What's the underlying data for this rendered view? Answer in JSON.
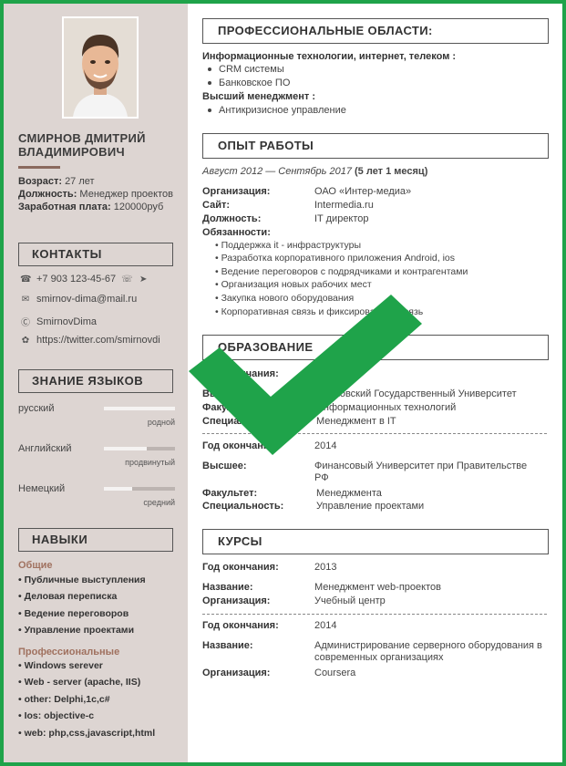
{
  "profile": {
    "name_line1": "СМИРНОВ ДМИТРИЙ",
    "name_line2": "ВЛАДИМИРОВИЧ",
    "age_label": "Возраст:",
    "age_value": "27 лет",
    "position_label": "Должность:",
    "position_value": "Менеджер проектов",
    "salary_label": "Заработная плата:",
    "salary_value": "120000руб"
  },
  "contacts": {
    "title": "КОНТАКТЫ",
    "phone": "+7 903 123-45-67",
    "email": "smirnov-dima@mail.ru",
    "skype": "SmirnovDima",
    "twitter": "https://twitter.com/smirnovdi"
  },
  "languages": {
    "title": "ЗНАНИЕ ЯЗЫКОВ",
    "items": [
      {
        "name": "русский",
        "level": "родной",
        "fill": 1.0
      },
      {
        "name": "Английский",
        "level": "продвинутый",
        "fill": 0.6
      },
      {
        "name": "Немецкий",
        "level": "средний",
        "fill": 0.4
      }
    ]
  },
  "skills": {
    "title": "НАВЫКИ",
    "general_title": "Общие",
    "general": [
      "Публичные выступления",
      "Деловая переписка",
      "Ведение переговоров",
      "Управление проектами"
    ],
    "pro_title": "Профессиональные",
    "pro": [
      "Windows serever",
      "Web - server (apache, IIS)",
      "other: Delphi,1c,c#",
      "Ios: objective-c",
      "web: php,css,javascript,html"
    ]
  },
  "areas": {
    "title": "ПРОФЕССИОНАЛЬНЫЕ ОБЛАСТИ:",
    "group1": "Информационные технологии, интернет, телеком :",
    "group1_items": [
      "CRM системы",
      "Банковское ПО"
    ],
    "group2": "Высший менеджмент :",
    "group2_items": [
      "Антикризисное управление"
    ]
  },
  "experience": {
    "title": "ОПЫТ РАБОТЫ",
    "period": "Август 2012 — Сентябрь 2017",
    "duration": "(5 лет 1 месяц)",
    "org_label": "Организация:",
    "org_value": "ОАО «Интер-медиа»",
    "site_label": "Сайт:",
    "site_value": "Intermedia.ru",
    "pos_label": "Должность:",
    "pos_value": "IT директор",
    "duties_label": "Обязанности:",
    "duties": [
      "Поддержка it - инфраструктуры",
      "Разработка корпоративного приложения Android, ios",
      "Ведение переговоров с подрядчиками и контрагентами",
      "Организация новых рабочих мест",
      "Закупка нового оборудования",
      "Корпоративная связь и фиксированная связь"
    ]
  },
  "education": {
    "title": "ОБРАЗОВАНИЕ",
    "entries": [
      {
        "year_label": "Год окончания:",
        "year": "",
        "type_label": "Высшее:",
        "type_value": "Московский Государственный Университет",
        "fac_label": "Факультет:",
        "fac_value": "Информационных технологий",
        "spec_label": "Специальность:",
        "spec_value": "Менеджмент в IT"
      },
      {
        "year_label": "Год окончания:",
        "year": "2014",
        "type_label": "Высшее:",
        "type_value": "Финансовый Университет при Правительстве РФ",
        "fac_label": "Факультет:",
        "fac_value": "Менеджмента",
        "spec_label": "Специальность:",
        "spec_value": "Управление проектами"
      }
    ]
  },
  "courses": {
    "title": "КУРСЫ",
    "entries": [
      {
        "year_label": "Год окончания:",
        "year": "2013",
        "name_label": "Название:",
        "name_value": "Менеджмент web-проектов",
        "org_label": "Организация:",
        "org_value": "Учебный центр"
      },
      {
        "year_label": "Год окончания:",
        "year": "2014",
        "name_label": "Название:",
        "name_value": "Администрирование серверного оборудования в современных организациях",
        "org_label": "Организация:",
        "org_value": "Coursera"
      }
    ]
  },
  "colors": {
    "frame": "#1fa34a",
    "sidebar": "#ddd5d2",
    "accent": "#8a6a5e",
    "check": "#1fa34a"
  }
}
